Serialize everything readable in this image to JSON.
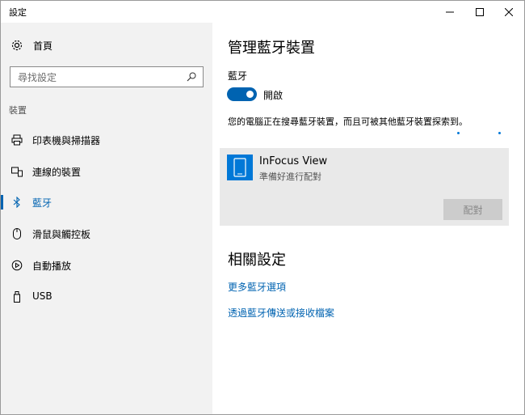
{
  "window": {
    "title": "設定"
  },
  "sidebar": {
    "home_label": "首頁",
    "search_placeholder": "尋找設定",
    "section_label": "裝置",
    "items": [
      {
        "label": "印表機與掃描器",
        "icon": "printer-icon"
      },
      {
        "label": "連線的裝置",
        "icon": "devices-icon"
      },
      {
        "label": "藍牙",
        "icon": "bluetooth-icon",
        "active": true
      },
      {
        "label": "滑鼠與觸控板",
        "icon": "mouse-icon"
      },
      {
        "label": "自動播放",
        "icon": "autoplay-icon"
      },
      {
        "label": "USB",
        "icon": "usb-icon"
      }
    ]
  },
  "main": {
    "title": "管理藍牙裝置",
    "bluetooth_label": "藍牙",
    "toggle_state": "開啟",
    "description": "您的電腦正在搜尋藍牙裝置，而且可被其他藍牙裝置探索到。",
    "device": {
      "name": "InFocus View",
      "status": "準備好進行配對",
      "pair_label": "配對"
    },
    "related_title": "相關設定",
    "links": [
      "更多藍牙選項",
      "透過藍牙傳送或接收檔案"
    ]
  },
  "colors": {
    "accent": "#0063b1",
    "device_tile": "#0078d7",
    "sidebar_bg": "#f2f2f2"
  }
}
